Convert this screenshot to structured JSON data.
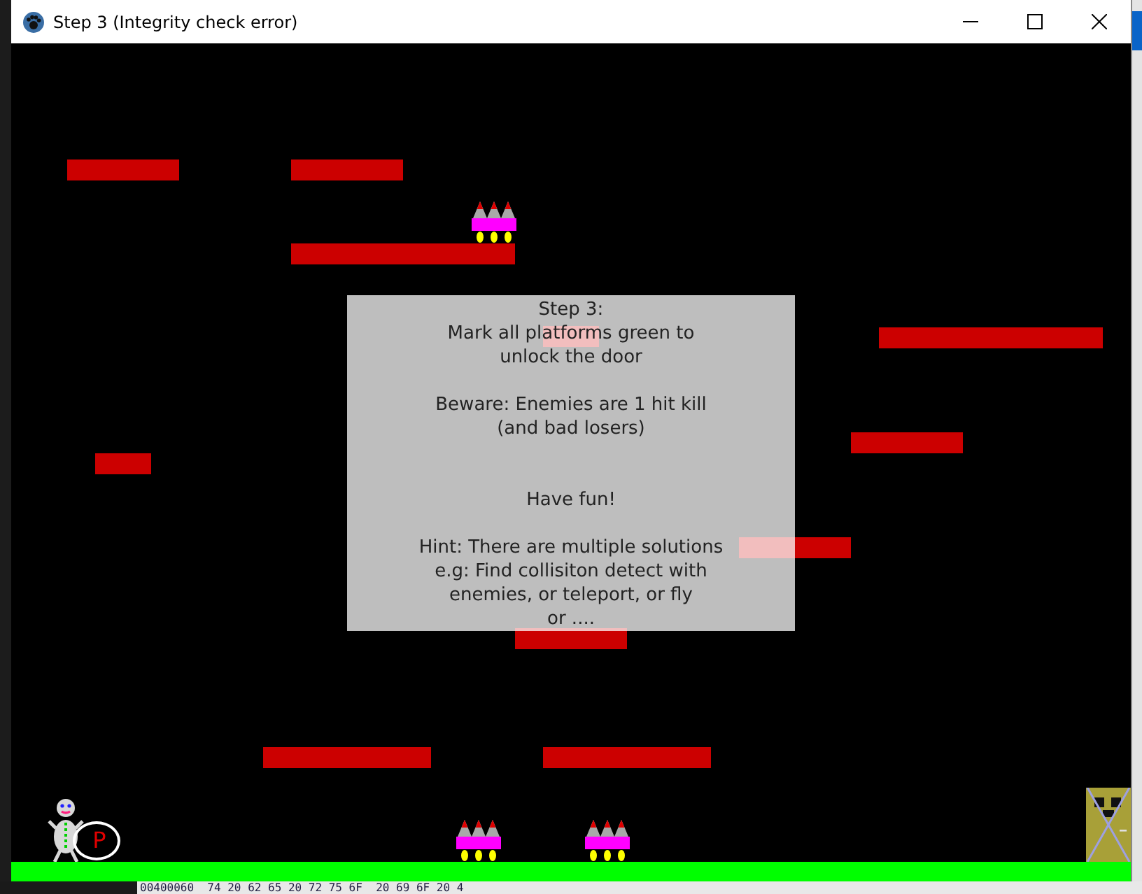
{
  "window": {
    "title": "Step 3 (Integrity check error)"
  },
  "dialog": {
    "paragraphs": [
      [
        "Step 3:",
        "Mark all platforms green to",
        "unlock the door"
      ],
      [
        "Beware: Enemies are 1 hit kill",
        "(and bad losers)"
      ],
      [
        "Have fun!"
      ],
      [
        "Hint: There are multiple solutions",
        "e.g: Find collisiton detect with",
        "enemies, or teleport, or fly",
        "or ...."
      ]
    ]
  },
  "player": {
    "bubble": "P"
  },
  "hex_dump": "00400060  74 20 62 65 20 72 75 6F  20 69 6F 20 4"
}
